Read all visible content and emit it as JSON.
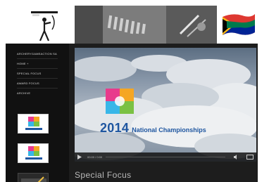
{
  "header": {
    "left_logo_icon": "archer-logo-icon",
    "right_logo_icon": "south-africa-flag-icon"
  },
  "sidebar": {
    "nav": [
      {
        "label": "Archerygameaction SA"
      },
      {
        "label": "Home +"
      },
      {
        "label": "Special Focus"
      },
      {
        "label": "Award Focus"
      },
      {
        "label": "Archive"
      }
    ],
    "thumbs": [
      {
        "icon": "championship-logo-icon"
      },
      {
        "icon": "championship-logo-icon"
      },
      {
        "icon": "championship-logo-icon"
      }
    ]
  },
  "video": {
    "year": "2014",
    "title": "National Championships",
    "time": "00:00 / 0:00",
    "progress": 0.0
  },
  "main": {
    "section_heading": "Special Focus"
  },
  "colors": {
    "sidebar_bg": "#111111",
    "main_bg": "#1d1d1d",
    "event_text": "#1f56a0",
    "flag_green": "#007a4d",
    "flag_gold": "#ffb612",
    "flag_red": "#de3831",
    "flag_blue": "#002395"
  }
}
